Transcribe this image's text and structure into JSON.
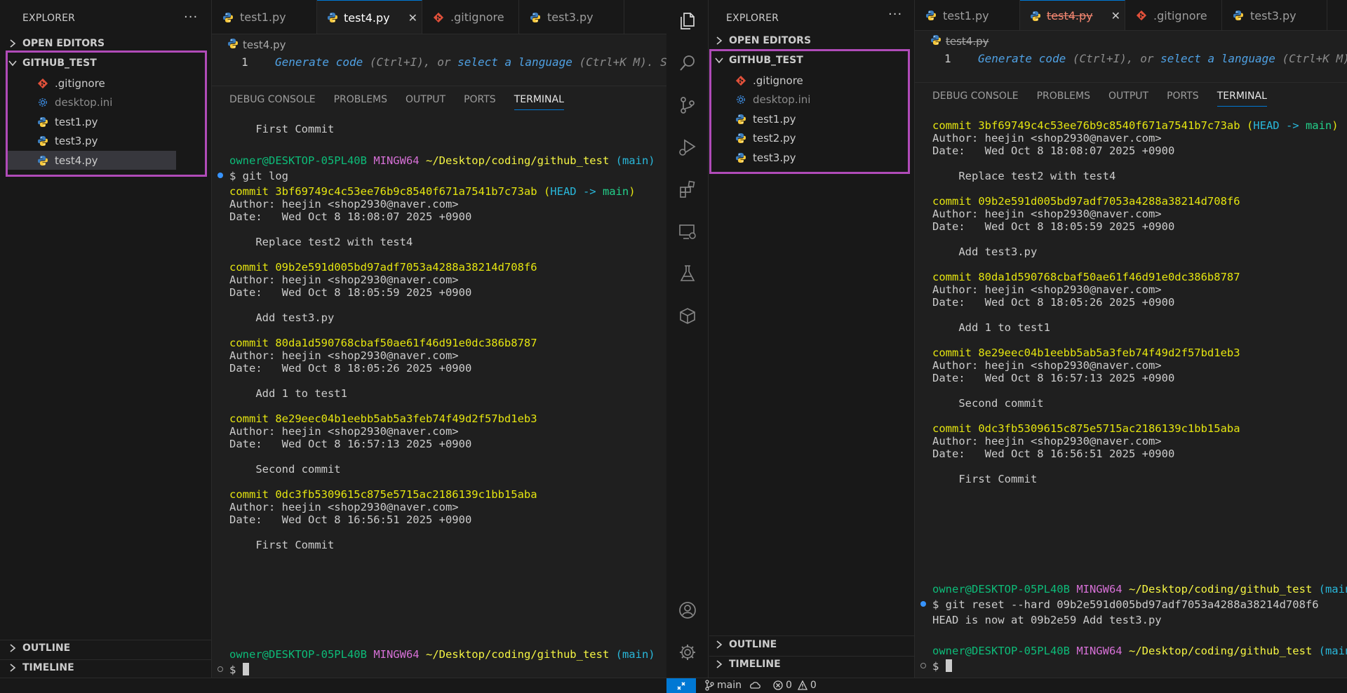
{
  "left": {
    "explorer": {
      "title": "EXPLORER",
      "more": "···",
      "open_editors": "OPEN EDITORS",
      "folder": "GITHUB_TEST",
      "files": [
        {
          "name": ".gitignore",
          "icon": "git-icon"
        },
        {
          "name": "desktop.ini",
          "icon": "gear-icon"
        },
        {
          "name": "test1.py",
          "icon": "python-icon"
        },
        {
          "name": "test3.py",
          "icon": "python-icon"
        },
        {
          "name": "test4.py",
          "icon": "python-icon"
        }
      ],
      "outline": "OUTLINE",
      "timeline": "TIMELINE"
    },
    "tabs": [
      {
        "label": "test1.py",
        "icon": "python-icon"
      },
      {
        "label": "test4.py",
        "icon": "python-icon",
        "close": "✕"
      },
      {
        "label": ".gitignore",
        "icon": "git-icon"
      },
      {
        "label": "test3.py",
        "icon": "python-icon"
      }
    ],
    "breadcrumb": "test4.py",
    "line_number": "1",
    "hint": {
      "a": "Generate code",
      "b": " (Ctrl+I), or ",
      "c": "select a language",
      "d": " (Ctrl+K M). S"
    },
    "panel_tabs": [
      "DEBUG CONSOLE",
      "PROBLEMS",
      "OUTPUT",
      "PORTS",
      "TERMINAL"
    ],
    "terminal": {
      "first_commit_top": "    First Commit",
      "prompt_user": "owner@DESKTOP-05PL40B",
      "prompt_sys": "MINGW64",
      "prompt_path": "~/Desktop/coding/github_test",
      "prompt_branch": "(main)",
      "cmd": "$ git log",
      "commits": [
        {
          "hash": "commit 3bf69749c4c53ee76b9c8540f671a7541b7c73ab",
          "head": true,
          "author": "Author: heejin <shop2930@naver.com>",
          "date": "Date:   Wed Oct 8 18:08:07 2025 +0900",
          "msg": "    Replace test2 with test4"
        },
        {
          "hash": "commit 09b2e591d005bd97adf7053a4288a38214d708f6",
          "author": "Author: heejin <shop2930@naver.com>",
          "date": "Date:   Wed Oct 8 18:05:59 2025 +0900",
          "msg": "    Add test3.py"
        },
        {
          "hash": "commit 80da1d590768cbaf50ae61f46d91e0dc386b8787",
          "author": "Author: heejin <shop2930@naver.com>",
          "date": "Date:   Wed Oct 8 18:05:26 2025 +0900",
          "msg": "    Add 1 to test1"
        },
        {
          "hash": "commit 8e29eec04b1eebb5ab5a3feb74f49d2f57bd1eb3",
          "author": "Author: heejin <shop2930@naver.com>",
          "date": "Date:   Wed Oct 8 16:57:13 2025 +0900",
          "msg": "    Second commit"
        },
        {
          "hash": "commit 0dc3fb5309615c875e5715ac2186139c1bb15aba",
          "author": "Author: heejin <shop2930@naver.com>",
          "date": "Date:   Wed Oct 8 16:56:51 2025 +0900",
          "msg": "    First Commit"
        }
      ],
      "head_open": " (",
      "head_label": "HEAD -> ",
      "head_branch": "main",
      "head_close": ")",
      "final_prompt": "$ "
    }
  },
  "right": {
    "explorer": {
      "title": "EXPLORER",
      "more": "···",
      "open_editors": "OPEN EDITORS",
      "folder": "GITHUB_TEST",
      "files": [
        {
          "name": ".gitignore",
          "icon": "git-icon"
        },
        {
          "name": "desktop.ini",
          "icon": "gear-icon"
        },
        {
          "name": "test1.py",
          "icon": "python-icon"
        },
        {
          "name": "test2.py",
          "icon": "python-icon"
        },
        {
          "name": "test3.py",
          "icon": "python-icon"
        }
      ],
      "outline": "OUTLINE",
      "timeline": "TIMELINE"
    },
    "tabs": [
      {
        "label": "test1.py",
        "icon": "python-icon"
      },
      {
        "label": "test4.py",
        "icon": "python-icon",
        "close": "✕",
        "deleted": true
      },
      {
        "label": ".gitignore",
        "icon": "git-icon"
      },
      {
        "label": "test3.py",
        "icon": "python-icon"
      }
    ],
    "breadcrumb": "test4.py",
    "line_number": "1",
    "hint": {
      "a": "Generate code",
      "b": " (Ctrl+I), or ",
      "c": "select a language",
      "d": " (Ctrl+K M)"
    },
    "panel_tabs": [
      "DEBUG CONSOLE",
      "PROBLEMS",
      "OUTPUT",
      "PORTS",
      "TERMINAL"
    ],
    "terminal": {
      "commits": [
        {
          "hash": "commit 3bf69749c4c53ee76b9c8540f671a7541b7c73ab",
          "head": true,
          "author": "Author: heejin <shop2930@naver.com>",
          "date": "Date:   Wed Oct 8 18:08:07 2025 +0900",
          "msg": "    Replace test2 with test4"
        },
        {
          "hash": "commit 09b2e591d005bd97adf7053a4288a38214d708f6",
          "author": "Author: heejin <shop2930@naver.com>",
          "date": "Date:   Wed Oct 8 18:05:59 2025 +0900",
          "msg": "    Add test3.py"
        },
        {
          "hash": "commit 80da1d590768cbaf50ae61f46d91e0dc386b8787",
          "author": "Author: heejin <shop2930@naver.com>",
          "date": "Date:   Wed Oct 8 18:05:26 2025 +0900",
          "msg": "    Add 1 to test1"
        },
        {
          "hash": "commit 8e29eec04b1eebb5ab5a3feb74f49d2f57bd1eb3",
          "author": "Author: heejin <shop2930@naver.com>",
          "date": "Date:   Wed Oct 8 16:57:13 2025 +0900",
          "msg": "    Second commit"
        },
        {
          "hash": "commit 0dc3fb5309615c875e5715ac2186139c1bb15aba",
          "author": "Author: heejin <shop2930@naver.com>",
          "date": "Date:   Wed Oct 8 16:56:51 2025 +0900",
          "msg": "    First Commit"
        }
      ],
      "head_open": " (",
      "head_label": "HEAD -> ",
      "head_branch": "main",
      "head_close": ")",
      "prompt_user": "owner@DESKTOP-05PL40B",
      "prompt_sys": "MINGW64",
      "prompt_path": "~/Desktop/coding/github_test",
      "prompt_branch": "(main)",
      "cmd": "$ git reset --hard 09b2e591d005bd97adf7053a4288a38214d708f6",
      "output": "HEAD is now at 09b2e59 Add test3.py",
      "final_prompt": "$ "
    }
  },
  "statusbar": {
    "branch": "main",
    "errors": "0",
    "warnings": "0"
  },
  "colors": {
    "accent": "#0078d4",
    "highlight": "#b04bb8",
    "commit_yellow": "#e5e510",
    "prompt_green": "#0dbc79",
    "mingw_magenta": "#d670d6",
    "branch_cyan": "#29b8db"
  }
}
